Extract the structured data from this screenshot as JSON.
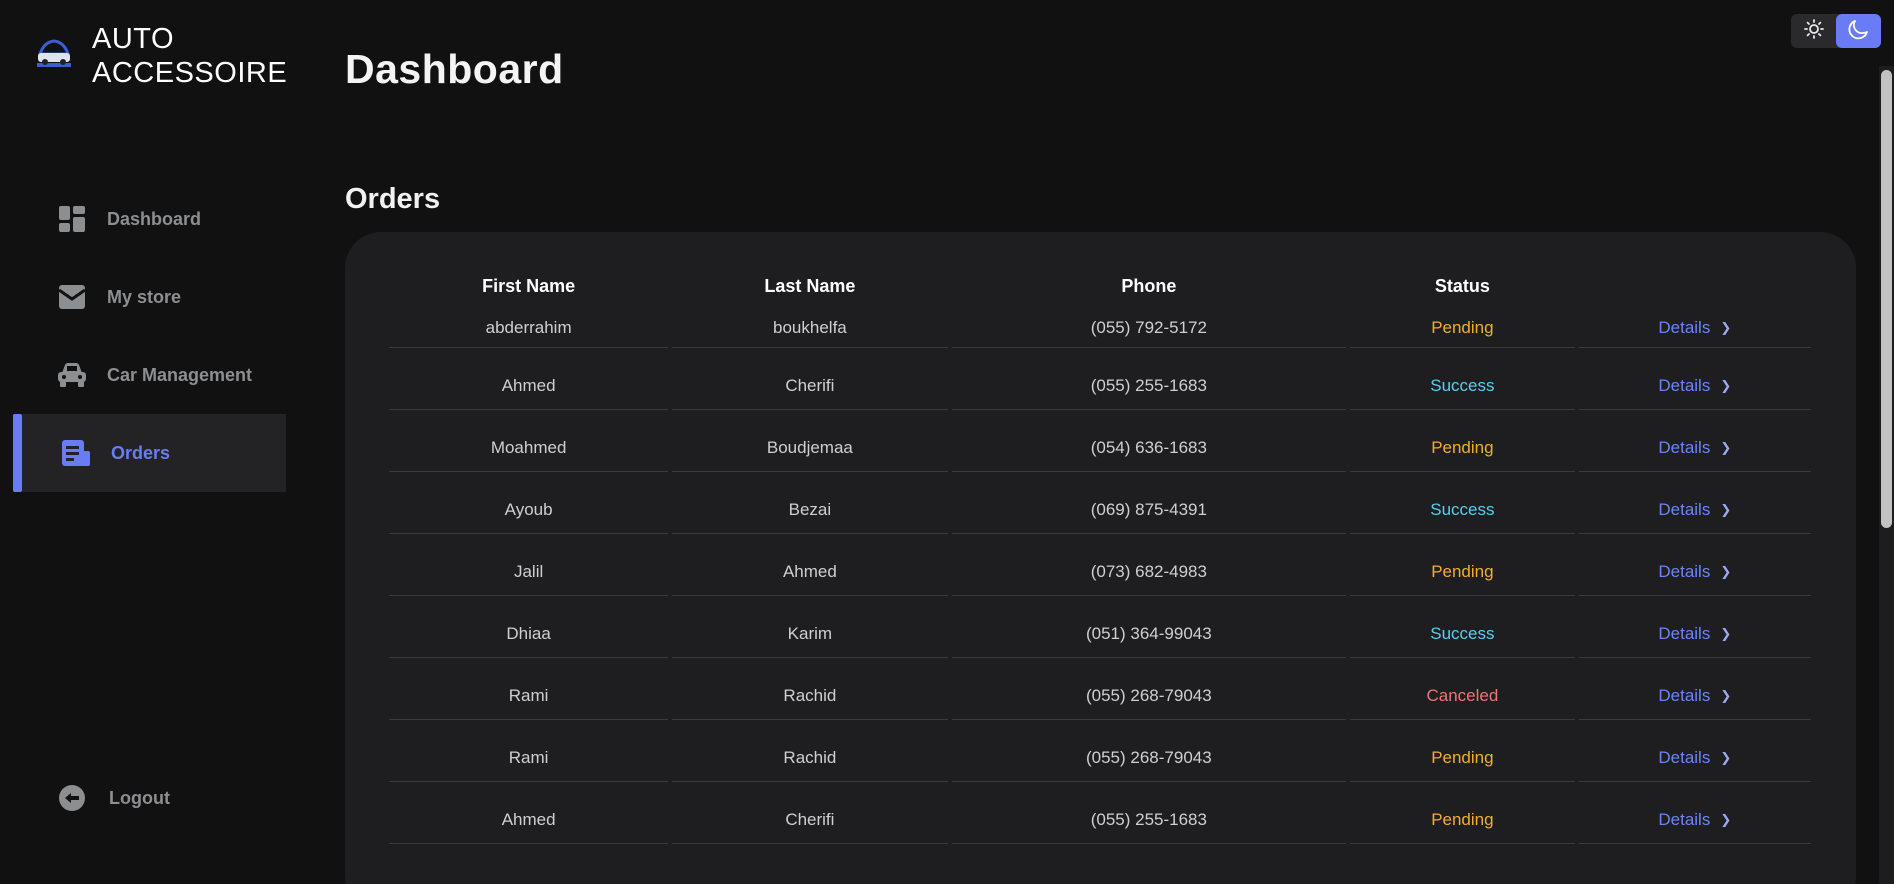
{
  "brand": {
    "line1": "AUTO",
    "line2": "ACCESSOIRE",
    "logo_icon": "car-logo-icon"
  },
  "sidebar": {
    "items": [
      {
        "label": "Dashboard",
        "icon": "dashboard-grid-icon",
        "active": false
      },
      {
        "label": "My store",
        "icon": "store-inbox-icon",
        "active": false
      },
      {
        "label": "Car Management",
        "icon": "car-icon",
        "active": false
      },
      {
        "label": "Orders",
        "icon": "orders-document-icon",
        "active": true
      }
    ],
    "logout": {
      "label": "Logout",
      "icon": "logout-arrow-icon"
    }
  },
  "header": {
    "title": "Dashboard"
  },
  "theme_toggle": {
    "options": [
      "light",
      "dark"
    ],
    "selected": "dark"
  },
  "orders": {
    "title": "Orders",
    "columns": [
      "First Name",
      "Last Name",
      "Phone",
      "Status"
    ],
    "details_label": "Details",
    "rows": [
      {
        "first": "abderrahim",
        "last": "boukhelfa",
        "phone": "(055) 792-5172",
        "status": "Pending"
      },
      {
        "first": "Ahmed",
        "last": "Cherifi",
        "phone": "(055) 255-1683",
        "status": "Success"
      },
      {
        "first": "Moahmed",
        "last": "Boudjemaa",
        "phone": "(054) 636-1683",
        "status": "Pending"
      },
      {
        "first": "Ayoub",
        "last": "Bezai",
        "phone": "(069) 875-4391",
        "status": "Success"
      },
      {
        "first": "Jalil",
        "last": "Ahmed",
        "phone": "(073) 682-4983",
        "status": "Pending"
      },
      {
        "first": "Dhiaa",
        "last": "Karim",
        "phone": "(051) 364-99043",
        "status": "Success"
      },
      {
        "first": "Rami",
        "last": "Rachid",
        "phone": "(055) 268-79043",
        "status": "Canceled"
      },
      {
        "first": "Rami",
        "last": "Rachid",
        "phone": "(055) 268-79043",
        "status": "Pending"
      },
      {
        "first": "Ahmed",
        "last": "Cherifi",
        "phone": "(055) 255-1683",
        "status": "Pending"
      }
    ]
  },
  "colors": {
    "accent": "#6a7cf5",
    "pending": "#f3ad2a",
    "success": "#5bcdf0",
    "canceled": "#f0737a"
  }
}
